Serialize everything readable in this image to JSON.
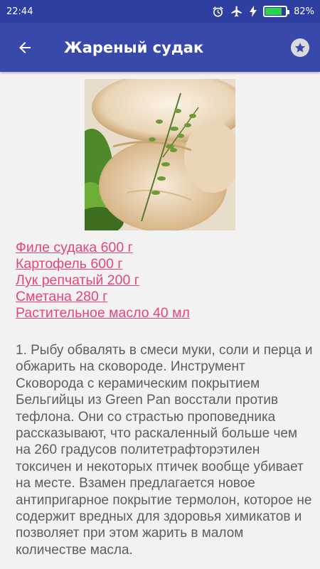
{
  "status_bar": {
    "time": "22:44",
    "battery_text": "82%",
    "battery_level": 0.82,
    "icons": [
      "alarm-icon",
      "airplane-icon",
      "charging-icon",
      "battery-icon"
    ]
  },
  "app_bar": {
    "title": "Жареный судак",
    "back_icon": "arrow-left-icon",
    "favorite_icon": "star-icon"
  },
  "recipe": {
    "photo_description": "fried-fish-with-thyme",
    "ingredients": [
      "Филе судака 600 г",
      "Картофель 600 г",
      "Лук репчатый 200 г",
      "Сметана 280 г",
      "Растительное масло 40 мл"
    ],
    "steps": "1. Рыбу обвалять в смеси муки, соли и перца и обжарить на сковороде. Инструмент Сковорода с керамическим покрытием Бельгийцы из Green Pan восстали против тефлона. Они со страстью проповедника рассказывают, что раскаленный больше чем на 260 градусов политетрафторэтилен токсичен и некоторых птичек вообще убивает на месте. Взамен предлагается новое антипригарное покрытие термолон, которое не содержит вредных для здоровья химикатов и позволяет при этом жарить в малом количестве масла."
  },
  "colors": {
    "status_bar": "#2f3fa1",
    "app_bar": "#3949ab",
    "link": "#e5457d",
    "body_text": "#5e5e5e",
    "background": "#f2f2f2"
  }
}
